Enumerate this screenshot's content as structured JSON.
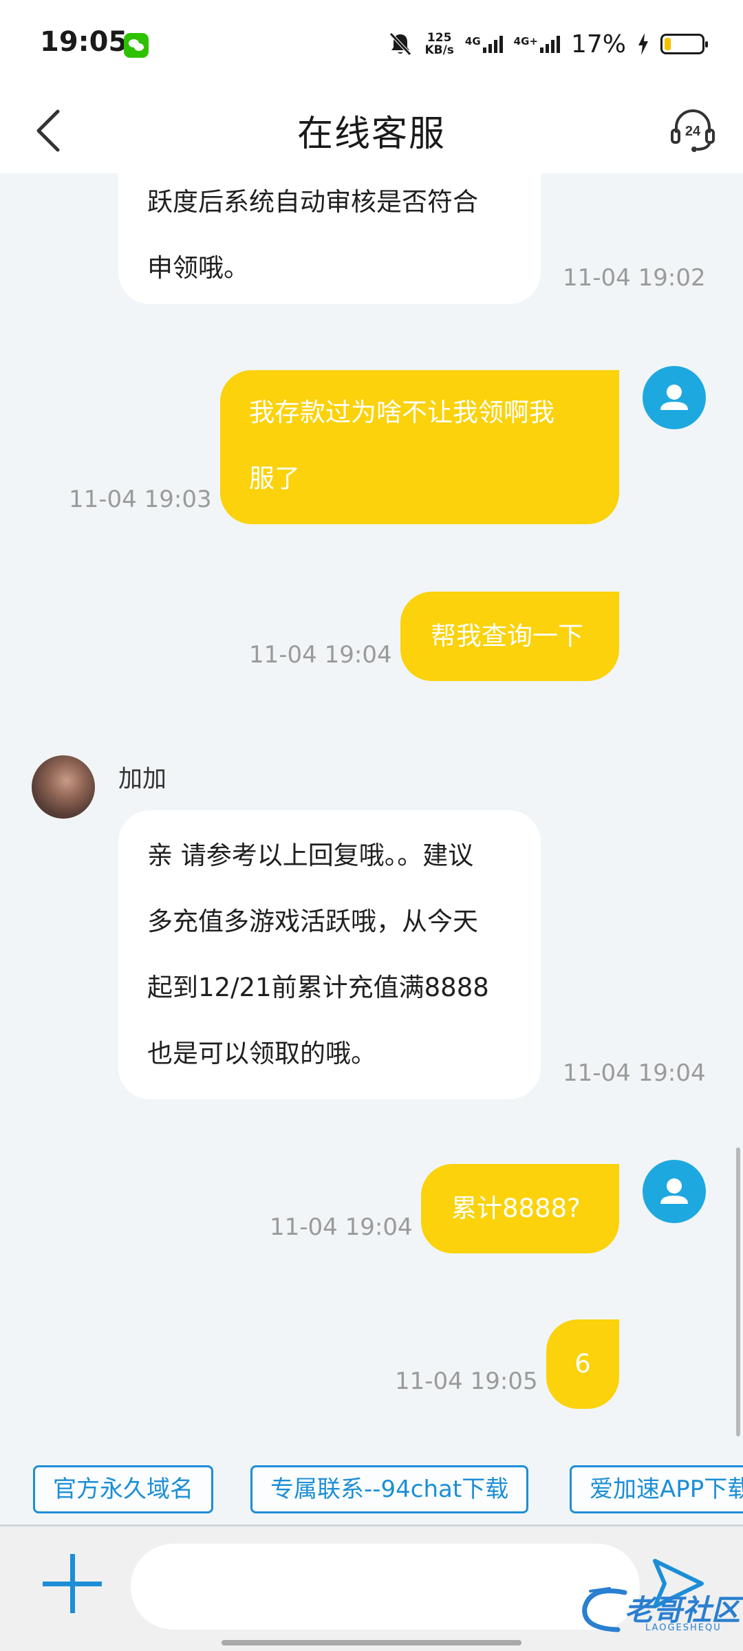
{
  "status_bar": {
    "time": "19:05",
    "speed_value": "125",
    "speed_unit": "KB/s",
    "net1": "4G",
    "net2": "4G+",
    "battery_pct": "17%",
    "battery_level": 0.17,
    "icons": [
      "wechat-icon",
      "mute-bell-icon",
      "signal-icon",
      "charging-icon",
      "battery-icon"
    ]
  },
  "header": {
    "title": "在线客服",
    "back_icon": "chevron-left-icon",
    "support_icon": "headset-24-icon",
    "support_badge": "24"
  },
  "messages": [
    {
      "sender": "agent",
      "lines": [
        "跃度后系统自动审核是否符合",
        "申领哦。"
      ],
      "time": "11-04 19:02"
    },
    {
      "sender": "user",
      "lines": [
        "我存款过为啥不让我领啊我",
        "服了"
      ],
      "time": "11-04 19:03"
    },
    {
      "sender": "user",
      "lines": [
        "帮我查询一下"
      ],
      "time": "11-04 19:04"
    },
    {
      "sender": "agent",
      "name": "加加",
      "lines": [
        "亲 请参考以上回复哦。。建议",
        "多充值多游戏活跃哦，从今天",
        "起到12/21前累计充值满8888",
        "也是可以领取的哦。"
      ],
      "time": "11-04 19:04"
    },
    {
      "sender": "user",
      "lines": [
        "累计8888?"
      ],
      "time": "11-04 19:04"
    },
    {
      "sender": "user",
      "lines": [
        "6"
      ],
      "time": "11-04 19:05"
    }
  ],
  "quick_replies": [
    "官方永久域名",
    "专属联系--94chat下载",
    "爱加速APP下载"
  ],
  "input": {
    "placeholder": ""
  },
  "watermark": {
    "text": "老哥社区",
    "sub": "LAOGESHEQU"
  },
  "colors": {
    "user_bubble": "#fbd20b",
    "agent_bubble": "#ffffff",
    "accent": "#1c8ed6",
    "user_avatar": "#1ea8e0",
    "background": "#f1f5f7"
  }
}
